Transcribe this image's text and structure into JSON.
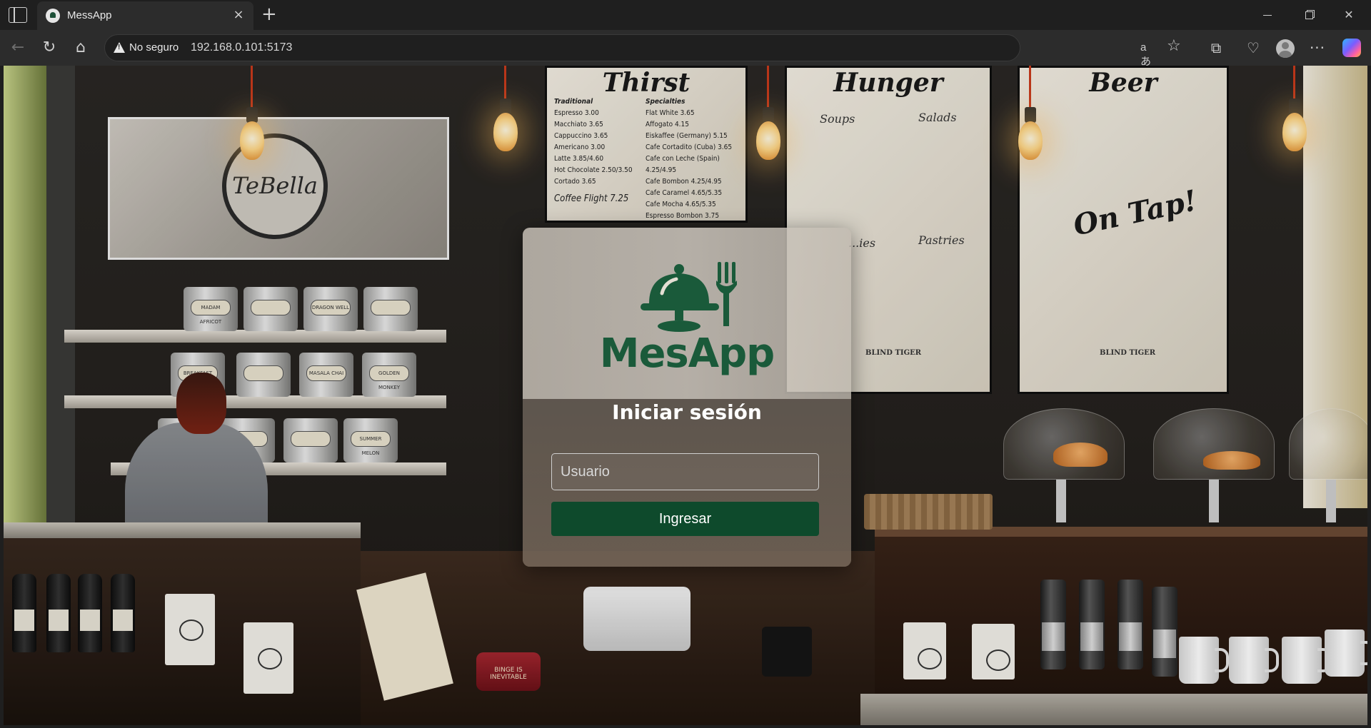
{
  "browser": {
    "tab": {
      "title": "MessApp",
      "close_glyph": "×"
    },
    "new_tab_glyph": "+",
    "window_controls": {
      "close_glyph": "✕"
    },
    "toolbar": {
      "back_glyph": "←",
      "reload_glyph": "↻",
      "home_glyph": "⌂",
      "security_label": "No seguro",
      "url": "192.168.0.101:5173",
      "read_aloud_glyph": "aあ",
      "favorite_glyph": "☆",
      "extensions_glyph": "⧉",
      "health_glyph": "♡",
      "more_glyph": "···"
    },
    "icons": [
      "sidebar-toggle-icon",
      "tab-favicon",
      "close-icon",
      "plus-icon",
      "minimize-icon",
      "restore-icon",
      "back-arrow-icon",
      "reload-icon",
      "home-icon",
      "warning-icon",
      "read-aloud-icon",
      "star-icon",
      "extensions-icon",
      "browser-essentials-icon",
      "profile-avatar-icon",
      "more-icon",
      "copilot-icon"
    ]
  },
  "background": {
    "sign_text": "TeBella",
    "menu_boards": [
      {
        "title": "Thirst",
        "columns": [
          {
            "heading": "Traditional",
            "items": [
              "Espresso 3.00",
              "Macchiato 3.65",
              "Cappuccino 3.65",
              "Americano 3.00",
              "Latte 3.85/4.60",
              "Hot Chocolate 2.50/3.50",
              "Cortado 3.65"
            ]
          },
          {
            "heading": "Specialties",
            "items": [
              "Flat White 3.65",
              "Affogato 4.15",
              "Eiskaffee (Germany) 5.15",
              "Cafe Cortadito (Cuba) 3.65",
              "Cafe con Leche (Spain) 4.25/4.95",
              "Cafe Bombon 4.25/4.95",
              "Cafe Caramel 4.65/5.35",
              "Cafe Mocha 4.65/5.35",
              "Espresso Bombon 3.75"
            ]
          }
        ],
        "footer": "Coffee Flight 7.25"
      },
      {
        "title": "Hunger",
        "subs": [
          "Soups",
          "Salads",
          "...ies",
          "Pastries"
        ],
        "badge": "BLIND TIGER"
      },
      {
        "title": "Beer",
        "subtitle": "On Tap!",
        "badge": "BLIND TIGER"
      }
    ],
    "tins": [
      "MADAM AFRICOT",
      "",
      "DRAGON WELL",
      "",
      "BREAKFAST",
      "",
      "MASALA CHAI",
      "GOLDEN MONKEY",
      "",
      "",
      "",
      "SUMMER MELON"
    ],
    "jar_text": "BINGE IS INEVITABLE"
  },
  "login": {
    "logo_icon": "cloche-fork-icon",
    "brand": "MesApp",
    "title": "Iniciar sesión",
    "username": {
      "value": "",
      "placeholder": "Usuario"
    },
    "submit_label": "Ingresar"
  },
  "colors": {
    "brand_green": "#1a5a3a",
    "button_green": "#0e4a2c",
    "browser_dark": "#1f1f1f",
    "toolbar": "#2c2c2c"
  }
}
